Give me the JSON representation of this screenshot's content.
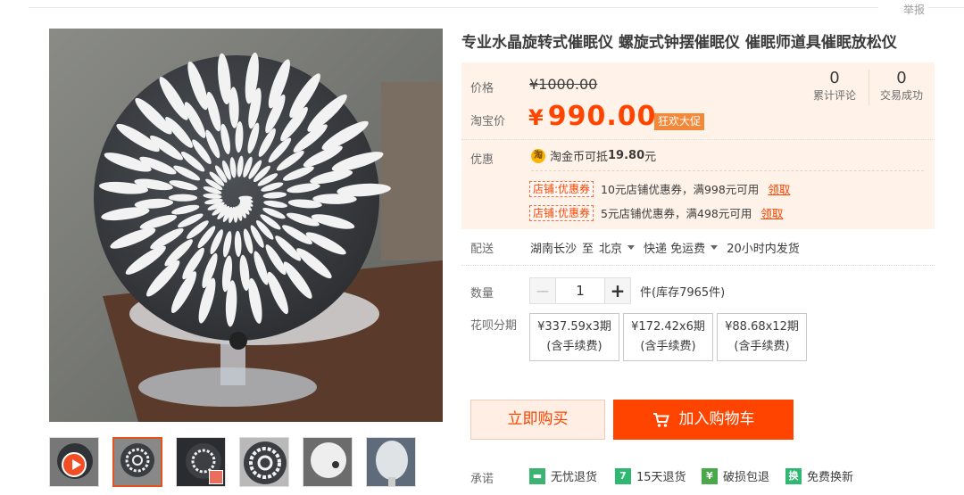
{
  "header": {
    "report_label": "举报"
  },
  "product": {
    "title": "专业水晶旋转式催眠仪 螺旋式钟摆催眠仪 催眠师道具催眠放松仪",
    "price_label": "价格",
    "original_price": "¥1000.00",
    "tb_price_label": "淘宝价",
    "currency": "¥",
    "price": "990.00",
    "promo_tag": "狂欢大促",
    "stats": [
      {
        "value": "0",
        "label": "累计评论"
      },
      {
        "value": "0",
        "label": "交易成功"
      }
    ]
  },
  "discount": {
    "label": "优惠",
    "coin_icon": "淘",
    "coin_text": "淘金币可抵",
    "coin_amount": "19.80",
    "coin_unit": "元",
    "coupons": [
      {
        "tag": "店铺:优惠券",
        "text": "10元店铺优惠券，满998元可用",
        "action": "领取"
      },
      {
        "tag": "店铺:优惠券",
        "text": "5元店铺优惠券，满498元可用",
        "action": "领取"
      }
    ]
  },
  "shipping": {
    "label": "配送",
    "from": "湖南长沙",
    "to_word": "至",
    "to": "北京",
    "method": "快递 免运费",
    "dispatch": "20小时内发货"
  },
  "quantity": {
    "label": "数量",
    "minus": "−",
    "value": "1",
    "plus": "+",
    "stock": "件(库存7965件)"
  },
  "installments": {
    "label": "花呗分期",
    "options": [
      {
        "line1": "¥337.59x3期",
        "line2": "(含手续费)"
      },
      {
        "line1": "¥172.42x6期",
        "line2": "(含手续费)"
      },
      {
        "line1": "¥88.68x12期",
        "line2": "(含手续费)"
      }
    ]
  },
  "actions": {
    "buy_now": "立即购买",
    "add_to_cart": "加入购物车"
  },
  "promise": {
    "label": "承诺",
    "items": [
      {
        "icon": "truck-icon",
        "text": "无忧退货",
        "color": "#3cb371"
      },
      {
        "icon": "seven-day-icon",
        "text": "15天退货",
        "color": "#2eb872"
      },
      {
        "icon": "shield-icon",
        "text": "破损包退",
        "color": "#49a94a"
      },
      {
        "icon": "exchange-icon",
        "text": "免费换新",
        "color": "#2eb872"
      }
    ]
  },
  "colors": {
    "accent": "#ff4400",
    "panel_bg": "#fff2e8",
    "promo_tag": "#f28838"
  }
}
